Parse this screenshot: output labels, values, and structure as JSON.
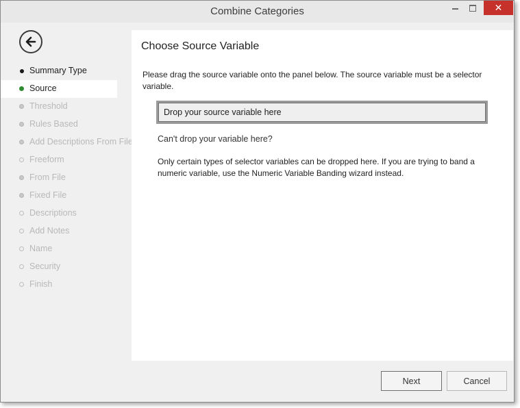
{
  "window": {
    "title": "Combine Categories",
    "controls": {
      "minimize": "minimize-icon",
      "maximize": "maximize-icon",
      "close": "✕"
    }
  },
  "sidebar": {
    "back_icon": "back-arrow-icon",
    "items": [
      {
        "label": "Summary Type",
        "state": "done"
      },
      {
        "label": "Source",
        "state": "active"
      },
      {
        "label": "Threshold",
        "state": "pending"
      },
      {
        "label": "Rules Based",
        "state": "pending"
      },
      {
        "label": "Add Descriptions From File",
        "state": "pending"
      },
      {
        "label": "Freeform",
        "state": "future"
      },
      {
        "label": "From File",
        "state": "pending"
      },
      {
        "label": "Fixed File",
        "state": "pending"
      },
      {
        "label": "Descriptions",
        "state": "future"
      },
      {
        "label": "Add Notes",
        "state": "future"
      },
      {
        "label": "Name",
        "state": "future"
      },
      {
        "label": "Security",
        "state": "future"
      },
      {
        "label": "Finish",
        "state": "future"
      }
    ]
  },
  "main": {
    "heading": "Choose Source Variable",
    "instructions": "Please drag the source variable onto the panel below. The source variable must be a selector variable.",
    "dropzone_text": "Drop your source variable here",
    "help_title": "Can't drop your variable here?",
    "help_text": "Only certain types of selector variables can be dropped here. If you are trying to band a numeric variable, use the Numeric Variable Banding wizard instead."
  },
  "footer": {
    "next_label": "Next",
    "cancel_label": "Cancel"
  },
  "colors": {
    "close_button": "#c7312b",
    "active_marker": "#2f8b2f",
    "background": "#f0f0f0",
    "panel": "#ffffff"
  }
}
